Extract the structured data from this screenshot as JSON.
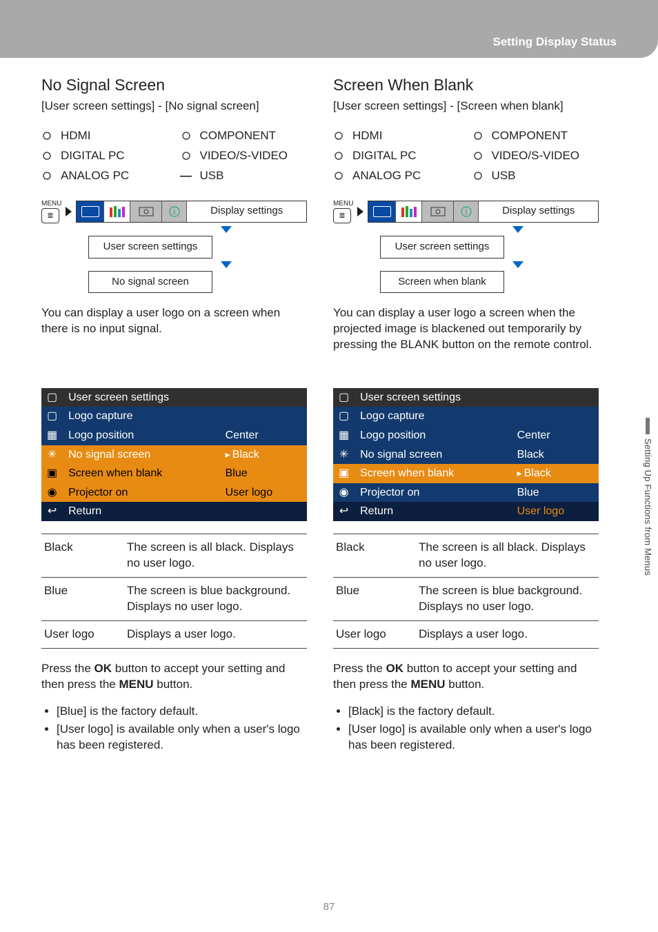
{
  "header": {
    "title": "Setting Display Status"
  },
  "side_tab": "Setting Up Functions from Menus",
  "page_number": "87",
  "left": {
    "title": "No Signal Screen",
    "breadcrumb": "[User screen settings] - [No signal screen]",
    "inputs_left": [
      "HDMI",
      "DIGITAL PC",
      "ANALOG PC"
    ],
    "inputs_right": [
      "COMPONENT",
      "VIDEO/S-VIDEO",
      "USB"
    ],
    "inputs_right_usb_dash": true,
    "menu_label": "MENU",
    "tab_label": "Display settings",
    "path_1": "User screen settings",
    "path_2": "No signal screen",
    "body": "You can display a user logo on a screen when there is no input signal.",
    "osd_title": "User screen settings",
    "osd_rows": [
      {
        "label": "Logo capture",
        "value": "",
        "style": "row-dark"
      },
      {
        "label": "Logo position",
        "value": "Center",
        "style": "row-dark"
      },
      {
        "label": "No signal screen",
        "value": "Black",
        "style": "row-sel",
        "caret": true
      },
      {
        "label": "Screen when blank",
        "value": "Blue",
        "style": "row-org"
      },
      {
        "label": "Projector on",
        "value": "User logo",
        "style": "row-org"
      },
      {
        "label": "Return",
        "value": "",
        "style": "row-navy"
      }
    ],
    "options": [
      {
        "name": "Black",
        "desc": "The screen is all black. Displays no user logo."
      },
      {
        "name": "Blue",
        "desc": "The screen is blue background. Displays no user logo."
      },
      {
        "name": "User logo",
        "desc": "Displays a user logo."
      }
    ],
    "press": [
      "Press the ",
      "OK",
      " button to accept your setting and then press the ",
      "MENU",
      " button."
    ],
    "bullets": [
      "[Blue] is the factory default.",
      "[User logo] is available only when a user's logo has been registered."
    ]
  },
  "right": {
    "title": "Screen When Blank",
    "breadcrumb": "[User screen settings] - [Screen when blank]",
    "inputs_left": [
      "HDMI",
      "DIGITAL PC",
      "ANALOG PC"
    ],
    "inputs_right": [
      "COMPONENT",
      "VIDEO/S-VIDEO",
      "USB"
    ],
    "inputs_right_usb_dash": false,
    "menu_label": "MENU",
    "tab_label": "Display settings",
    "path_1": "User screen settings",
    "path_2": "Screen when blank",
    "body": "You can display a user logo a screen when the projected image is blackened out temporarily by pressing the BLANK button on the remote control.",
    "osd_title": "User screen settings",
    "osd_rows": [
      {
        "label": "Logo capture",
        "value": "",
        "style": "row-dark"
      },
      {
        "label": "Logo position",
        "value": "Center",
        "style": "row-dark"
      },
      {
        "label": "No signal screen",
        "value": "Black",
        "style": "row-dark"
      },
      {
        "label": "Screen when blank",
        "value": "Black",
        "style": "row-sel",
        "caret": true
      },
      {
        "label": "Projector on",
        "value": "Blue",
        "style": "row-dark"
      },
      {
        "label": "Return",
        "value": "User logo",
        "style": "row-navy",
        "val_orange": true
      }
    ],
    "options": [
      {
        "name": "Black",
        "desc": "The screen is all black. Displays no user logo."
      },
      {
        "name": "Blue",
        "desc": "The screen is blue background. Displays no user logo."
      },
      {
        "name": "User logo",
        "desc": "Displays a user logo."
      }
    ],
    "press": [
      "Press the ",
      "OK",
      " button to accept your setting and then press the ",
      "MENU",
      " button."
    ],
    "bullets": [
      "[Black] is the factory default.",
      "[User logo] is available only when a user's logo has been registered."
    ]
  }
}
